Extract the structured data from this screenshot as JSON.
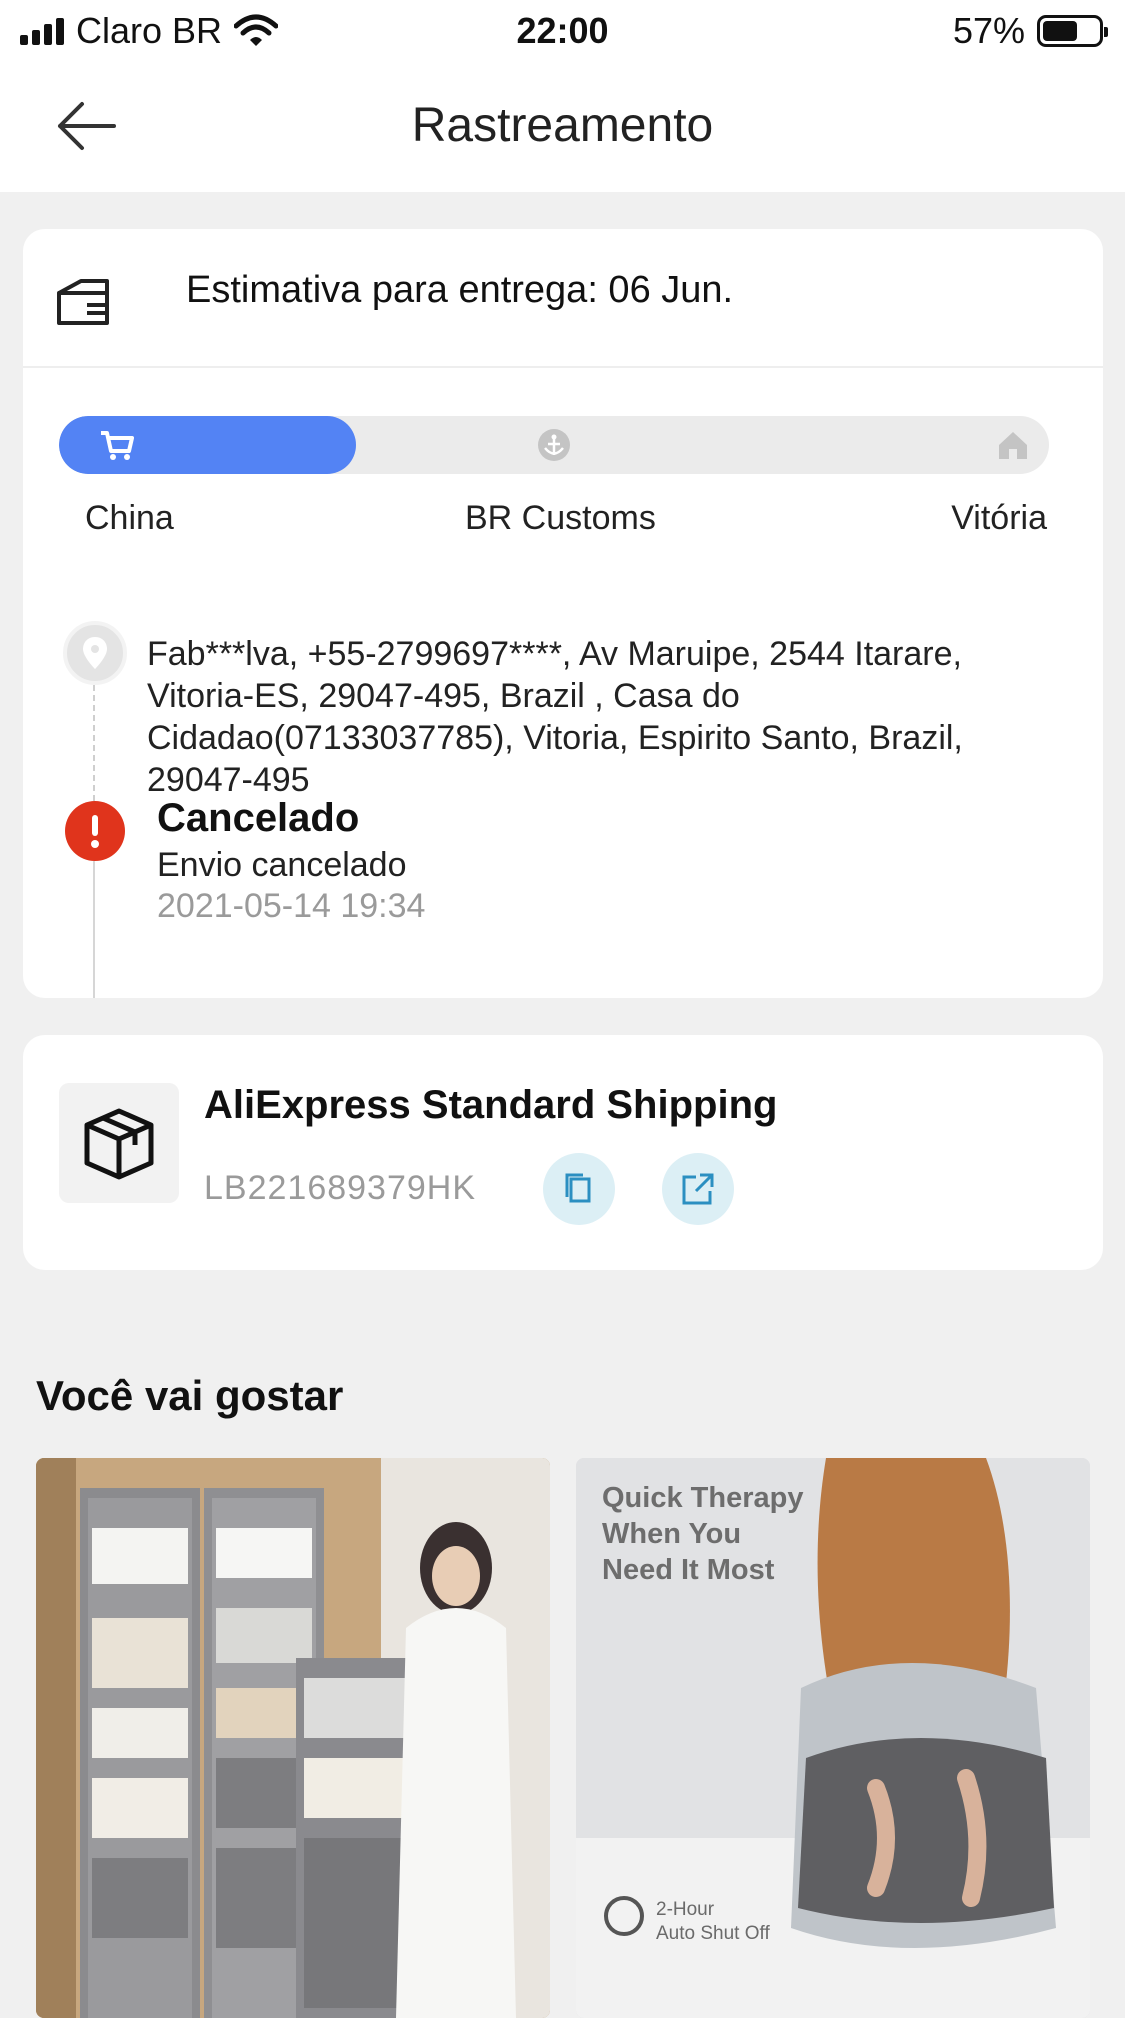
{
  "status_bar": {
    "carrier": "Claro BR",
    "time": "22:00",
    "battery": "57%",
    "battery_level": 0.57
  },
  "header": {
    "title": "Rastreamento",
    "back_icon": "arrow-left-icon"
  },
  "tracking": {
    "eta": "Estimativa para entrega: 06 Jun.",
    "progress_fraction": 0.3,
    "stages": [
      {
        "label": "China",
        "icon": "cart-icon"
      },
      {
        "label": "BR Customs",
        "icon": "anchor-icon"
      },
      {
        "label": "Vitória",
        "icon": "house-icon"
      }
    ],
    "address": "Fab***lva,  +55-2799697****,  Av Maruipe, 2544 Itarare, Vitoria-ES, 29047-495, Brazil , Casa do Cidadao(07133037785),  Vitoria,  Espirito Santo,  Brazil,  29047-495",
    "status": {
      "title": "Cancelado",
      "description": "Envio cancelado",
      "timestamp": "2021-05-14 19:34"
    },
    "colors": {
      "progress": "#5383f4",
      "alert": "#e0341c"
    }
  },
  "shipping": {
    "method": "AliExpress Standard Shipping",
    "tracking_number": "LB221689379HK",
    "copy_icon": "copy-icon",
    "open_icon": "external-link-icon"
  },
  "recommendations": {
    "title": "Você vai gostar",
    "products": [
      {
        "image": "closet-organizer-photo"
      },
      {
        "image": "heating-pad-photo",
        "headline": "Quick Therapy\nWhen You\nNeed It Most",
        "badge": "2-Hour\nAuto Shut Off"
      }
    ]
  }
}
